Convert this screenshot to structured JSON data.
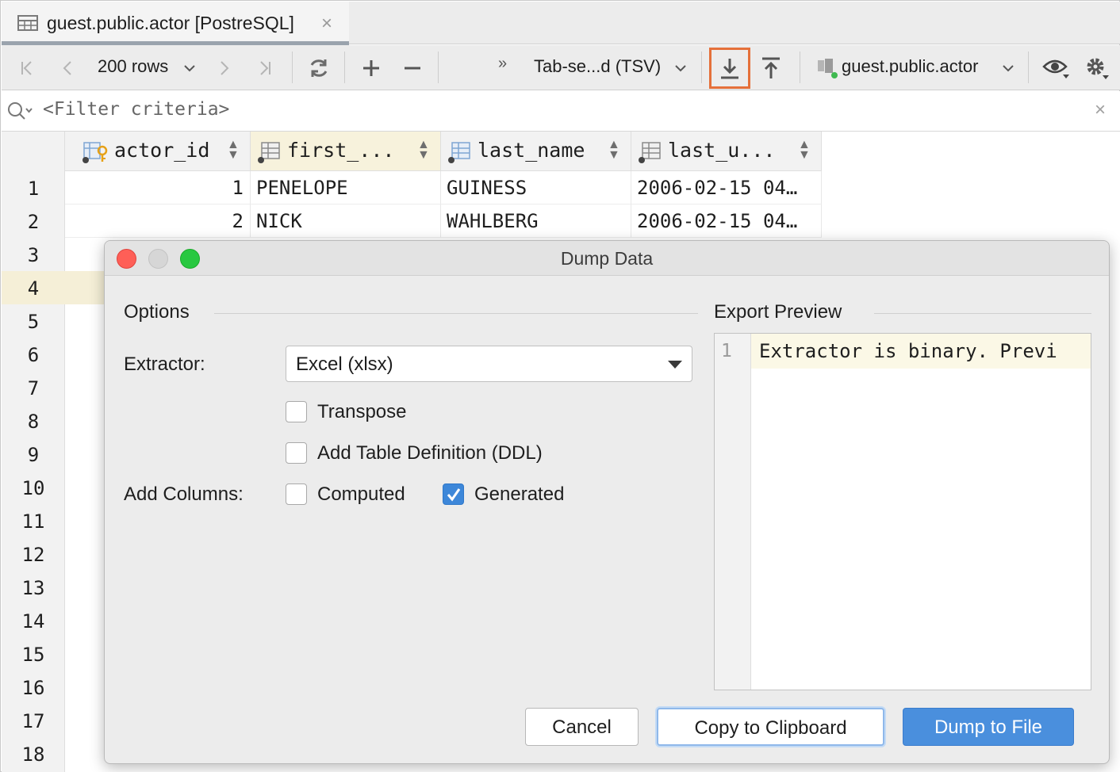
{
  "tab": {
    "title": "guest.public.actor [PostreSQL]",
    "close": "×"
  },
  "toolbar": {
    "rows_label": "200 rows",
    "more": "»",
    "format_label": "Tab-se...d (TSV)",
    "datasource_label": "guest.public.actor"
  },
  "filter": {
    "placeholder": "<Filter criteria>",
    "clear": "×"
  },
  "columns": [
    "actor_id",
    "first_...",
    "last_name",
    "last_u..."
  ],
  "rows": [
    {
      "num": "1",
      "actor_id": "1",
      "first_name": "PENELOPE",
      "last_name": "GUINESS",
      "last_update": "2006-02-15 04…"
    },
    {
      "num": "2",
      "actor_id": "2",
      "first_name": "NICK",
      "last_name": "WAHLBERG",
      "last_update": "2006-02-15 04…"
    }
  ],
  "row_numbers": [
    "1",
    "2",
    "3",
    "4",
    "5",
    "6",
    "7",
    "8",
    "9",
    "10",
    "11",
    "12",
    "13",
    "14",
    "15",
    "16",
    "17",
    "18"
  ],
  "dialog": {
    "title": "Dump Data",
    "options_title": "Options",
    "preview_title": "Export Preview",
    "extractor_label": "Extractor:",
    "extractor_value": "Excel (xlsx)",
    "transpose": "Transpose",
    "add_ddl": "Add Table Definition (DDL)",
    "add_columns_label": "Add Columns:",
    "computed": "Computed",
    "generated": "Generated",
    "preview_line_number": "1",
    "preview_text": "Extractor is binary. Previ",
    "cancel": "Cancel",
    "copy": "Copy to Clipboard",
    "dump": "Dump to File"
  },
  "colors": {
    "accent": "#4a8fdd",
    "highlight_border": "#e5703a",
    "selected_row": "#f5efd7"
  }
}
